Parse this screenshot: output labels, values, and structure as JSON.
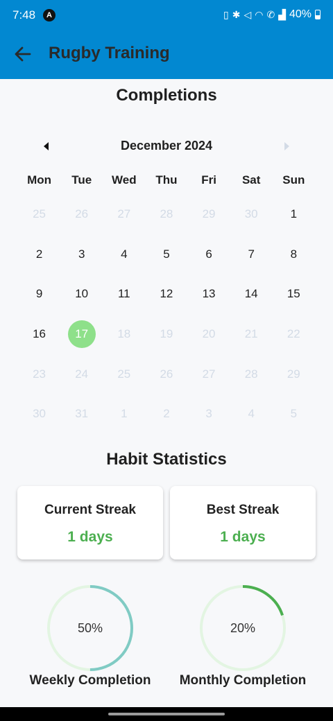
{
  "status_bar": {
    "time": "7:48",
    "app_icon": "A",
    "battery": "40%",
    "icons": [
      "vibrate-icon",
      "bluetooth-icon",
      "mute-icon",
      "wifi-icon",
      "call-icon",
      "signal-icon"
    ]
  },
  "app_bar": {
    "title": "Rugby Training",
    "back_icon": "arrow-back-icon"
  },
  "calendar": {
    "section_title": "Completions",
    "month": "December 2024",
    "weekdays": [
      "Mon",
      "Tue",
      "Wed",
      "Thu",
      "Fri",
      "Sat",
      "Sun"
    ],
    "weeks": [
      [
        {
          "d": "25",
          "m": true
        },
        {
          "d": "26",
          "m": true
        },
        {
          "d": "27",
          "m": true
        },
        {
          "d": "28",
          "m": true
        },
        {
          "d": "29",
          "m": true
        },
        {
          "d": "30",
          "m": true
        },
        {
          "d": "1",
          "m": false
        }
      ],
      [
        {
          "d": "2",
          "m": false
        },
        {
          "d": "3",
          "m": false
        },
        {
          "d": "4",
          "m": false
        },
        {
          "d": "5",
          "m": false
        },
        {
          "d": "6",
          "m": false
        },
        {
          "d": "7",
          "m": false
        },
        {
          "d": "8",
          "m": false
        }
      ],
      [
        {
          "d": "9",
          "m": false
        },
        {
          "d": "10",
          "m": false
        },
        {
          "d": "11",
          "m": false
        },
        {
          "d": "12",
          "m": false
        },
        {
          "d": "13",
          "m": false
        },
        {
          "d": "14",
          "m": false
        },
        {
          "d": "15",
          "m": false
        }
      ],
      [
        {
          "d": "16",
          "m": false
        },
        {
          "d": "17",
          "m": false,
          "today": true
        },
        {
          "d": "18",
          "m": true
        },
        {
          "d": "19",
          "m": true
        },
        {
          "d": "20",
          "m": true
        },
        {
          "d": "21",
          "m": true
        },
        {
          "d": "22",
          "m": true
        }
      ],
      [
        {
          "d": "23",
          "m": true
        },
        {
          "d": "24",
          "m": true
        },
        {
          "d": "25",
          "m": true
        },
        {
          "d": "26",
          "m": true
        },
        {
          "d": "27",
          "m": true
        },
        {
          "d": "28",
          "m": true
        },
        {
          "d": "29",
          "m": true
        }
      ],
      [
        {
          "d": "30",
          "m": true
        },
        {
          "d": "31",
          "m": true
        },
        {
          "d": "1",
          "m": true
        },
        {
          "d": "2",
          "m": true
        },
        {
          "d": "3",
          "m": true
        },
        {
          "d": "4",
          "m": true
        },
        {
          "d": "5",
          "m": true
        }
      ]
    ],
    "today_color": "#8ee08a"
  },
  "stats": {
    "section_title": "Habit Statistics",
    "current_streak": {
      "label": "Current Streak",
      "value": "1 days"
    },
    "best_streak": {
      "label": "Best Streak",
      "value": "1 days"
    },
    "weekly": {
      "label": "Weekly Completion",
      "percent_text": "50%",
      "fraction": 0.5,
      "color": "#80cbc4"
    },
    "monthly": {
      "label": "Monthly Completion",
      "percent_text": "20%",
      "fraction": 0.2,
      "color": "#4caf50"
    },
    "accent_color": "#4caf50",
    "ring_track_color": "#e3f5e2"
  },
  "colors": {
    "app_bar": "#0288d1"
  }
}
